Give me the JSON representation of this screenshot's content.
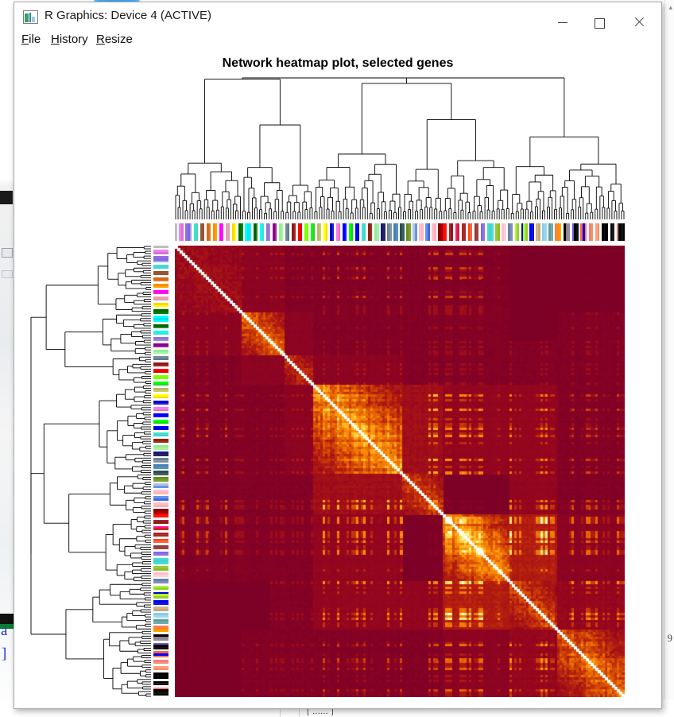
{
  "window": {
    "title": "R Graphics: Device 4 (ACTIVE)",
    "icon": "r-graphics-device-icon",
    "buttons": {
      "minimize": "–",
      "maximize": "□",
      "close": "✕"
    }
  },
  "menu": {
    "items": [
      {
        "label": "File",
        "accel": "F",
        "rest": "ile"
      },
      {
        "label": "History",
        "accel": "H",
        "rest": "istory"
      },
      {
        "label": "Resize",
        "accel": "R",
        "rest": "esize"
      }
    ]
  },
  "plot": {
    "title": "Network heatmap plot, selected genes",
    "type": "wgcna-network-heatmap",
    "n_genes": 188,
    "background_color": "#FFFFFF"
  },
  "chart_data": {
    "type": "heatmap",
    "title": "Network heatmap plot, selected genes",
    "xlabel": "",
    "ylabel": "",
    "description": "Topological overlap matrix (TOM) heatmap of selected genes with hierarchical clustering dendrograms on top and left, and module color bars between dendrograms and the matrix.",
    "n_rows": 188,
    "n_cols": 188,
    "symmetric": true,
    "diagonal_highlight": true,
    "value_range": [
      0,
      1
    ],
    "palette": {
      "name": "heat.colors-reversed",
      "low": "#7D0027",
      "mid_low": "#A81010",
      "mid": "#E05000",
      "mid_high": "#FFA500",
      "high": "#FFFF99",
      "top": "#FFFFE8"
    },
    "legend": {
      "shown": false,
      "position": "none"
    },
    "grid": false,
    "module_blocks": [
      {
        "name": "block-1",
        "start": 0,
        "end": 28,
        "strength": 0.3
      },
      {
        "name": "block-2",
        "start": 28,
        "end": 46,
        "strength": 0.78
      },
      {
        "name": "block-3",
        "start": 46,
        "end": 58,
        "strength": 0.55
      },
      {
        "name": "block-4",
        "start": 58,
        "end": 95,
        "strength": 0.92
      },
      {
        "name": "block-5",
        "start": 95,
        "end": 112,
        "strength": 0.7
      },
      {
        "name": "block-6",
        "start": 112,
        "end": 140,
        "strength": 0.95
      },
      {
        "name": "block-7",
        "start": 140,
        "end": 160,
        "strength": 0.62
      },
      {
        "name": "block-8",
        "start": 160,
        "end": 188,
        "strength": 0.74
      }
    ],
    "dendrogram_top": {
      "orientation": "hanging-down",
      "leaves": 188,
      "height_fraction": 0.32
    },
    "dendrogram_left": {
      "orientation": "hanging-right",
      "leaves": 188,
      "height_fraction": 0.3
    },
    "module_colors": [
      "#BEBEBE",
      "#FFFFFF",
      "#EE82EE",
      "#DA70D6",
      "#FFFFFF",
      "#9370DB",
      "#7B68EE",
      "#B0A0D0",
      "#FFFFFF",
      "#40E0D0",
      "#48D1CC",
      "#FFFFFF",
      "#8B5A3C",
      "#A0522D",
      "#FFFFFF",
      "#D2691E",
      "#E07B20",
      "#FFFFFF",
      "#FF8C00",
      "#FFA500",
      "#FFFFFF",
      "#FF00FF",
      "#FF1CDB",
      "#FFFFFF",
      "#E8A0B4",
      "#D8A0A8",
      "#FFFFFF",
      "#FFD700",
      "#FFFF00",
      "#FFFFFF",
      "#006400",
      "#008000",
      "#FFFFFF",
      "#00FFFF",
      "#00E5EE",
      "#00FFFF",
      "#FFFFFF",
      "#006400",
      "#228B22",
      "#FFFFFF",
      "#00FFFF",
      "#40E0D0",
      "#FFFFFF",
      "#9370DB",
      "#A98ACB",
      "#FFFFFF",
      "#8B008B",
      "#A020A0",
      "#FFFFFF",
      "#90EE90",
      "#98FB98",
      "#FFFFFF",
      "#778899",
      "#5F7C8A",
      "#FFFFFF",
      "#8B1A1A",
      "#B22222",
      "#FFFFFF",
      "#FF0000",
      "#E00000",
      "#FFFFFF",
      "#7FFF00",
      "#7CFC00",
      "#FFFFFF",
      "#00FF00",
      "#32CD32",
      "#FFFFFF",
      "#BDB76B",
      "#CDCD5C",
      "#FFFFFF",
      "#FFFF00",
      "#FFD700",
      "#FFFFFF",
      "#0000CD",
      "#1E1EE0",
      "#FFFFFF",
      "#EE82EE",
      "#FF69B4",
      "#FFFFFF",
      "#0000FF",
      "#1414FF",
      "#FFFFFF",
      "#00FF00",
      "#00E000",
      "#FFFFFF",
      "#0000FF",
      "#0000CD",
      "#FFFFFF",
      "#40E0D0",
      "#48D1CC",
      "#FFFFFF",
      "#8B2500",
      "#A52A2A",
      "#FFFFFF",
      "#90EE90",
      "#A8F0A8",
      "#FFFFFF",
      "#191970",
      "#22226E",
      "#FFFFFF",
      "#708090",
      "#8296A4",
      "#FFFFFF",
      "#4682B4",
      "#5590C0",
      "#FFFFFF",
      "#2F4F4F",
      "#3A6060",
      "#FFFFFF",
      "#6B8E23",
      "#7C9E30",
      "#FFFFFF",
      "#B0C4DE",
      "#6495ED",
      "#FFFFFF",
      "#FFC0CB",
      "#FFB6C1",
      "#FFFFFF",
      "#6495ED",
      "#4169E1",
      "#FFFFFF",
      "#FFC0CB",
      "#FFB0BC",
      "#FFFFFF",
      "#8B0000",
      "#A00000",
      "#FF0000",
      "#FF1010",
      "#FFFFFF",
      "#B22222",
      "#8B1A1A",
      "#FFFFFF",
      "#FF1493",
      "#CD2626",
      "#FFFFFF",
      "#B22222",
      "#A52A2A",
      "#FFFFFF",
      "#FF4500",
      "#FF6347",
      "#FFFFFF",
      "#8B3A3A",
      "#A04040",
      "#FFFFFF",
      "#7B68EE",
      "#9370DB",
      "#FFFFFF",
      "#40E0D0",
      "#48D1CC",
      "#40E0D0",
      "#FFFFFF",
      "#9ACD32",
      "#8FBC2F",
      "#FFFFFF",
      "#FFC0CB",
      "#FFD0DB",
      "#FFFFFF",
      "#6A7FA8",
      "#7B8FB8",
      "#FFFFFF",
      "#ADFF2F",
      "#9ACD32",
      "#FFFFFF",
      "#0000CD",
      "#ADFF2F",
      "#9ACD32",
      "#FFFFFF",
      "#0000FF",
      "#1414E0",
      "#FFFFFF",
      "#D2B48C",
      "#C8A87C",
      "#FFFFFF",
      "#87CEEB",
      "#9FD6F0",
      "#FFFFFF",
      "#5F9EA0",
      "#6FAEB0",
      "#FFFFFF",
      "#FF7F50",
      "#FF8C00",
      "#FFA500",
      "#FFFFFF",
      "#000000",
      "#8B7D8B",
      "#9A8C9A",
      "#FFFFFF",
      "#6A5ACD",
      "#000000",
      "#111111",
      "#FFFFFF",
      "#FF6347",
      "#0000FF",
      "#FF7F50",
      "#FFFFFF",
      "#FA8072",
      "#E9967A",
      "#FFFFFF",
      "#FFA07A",
      "#FF8C69",
      "#FFFFFF",
      "#000000",
      "#0A0A0A",
      "#000000",
      "#FFFFFF",
      "#000000",
      "#1A1A1A",
      "#FFFFFF",
      "#FA8072",
      "#000000",
      "#111111",
      "#000000"
    ]
  },
  "desktop": {
    "left_glyph_1": "a",
    "left_glyph_2": "]",
    "right_glyph": "9",
    "bottom_text": "[ ...... ]"
  }
}
